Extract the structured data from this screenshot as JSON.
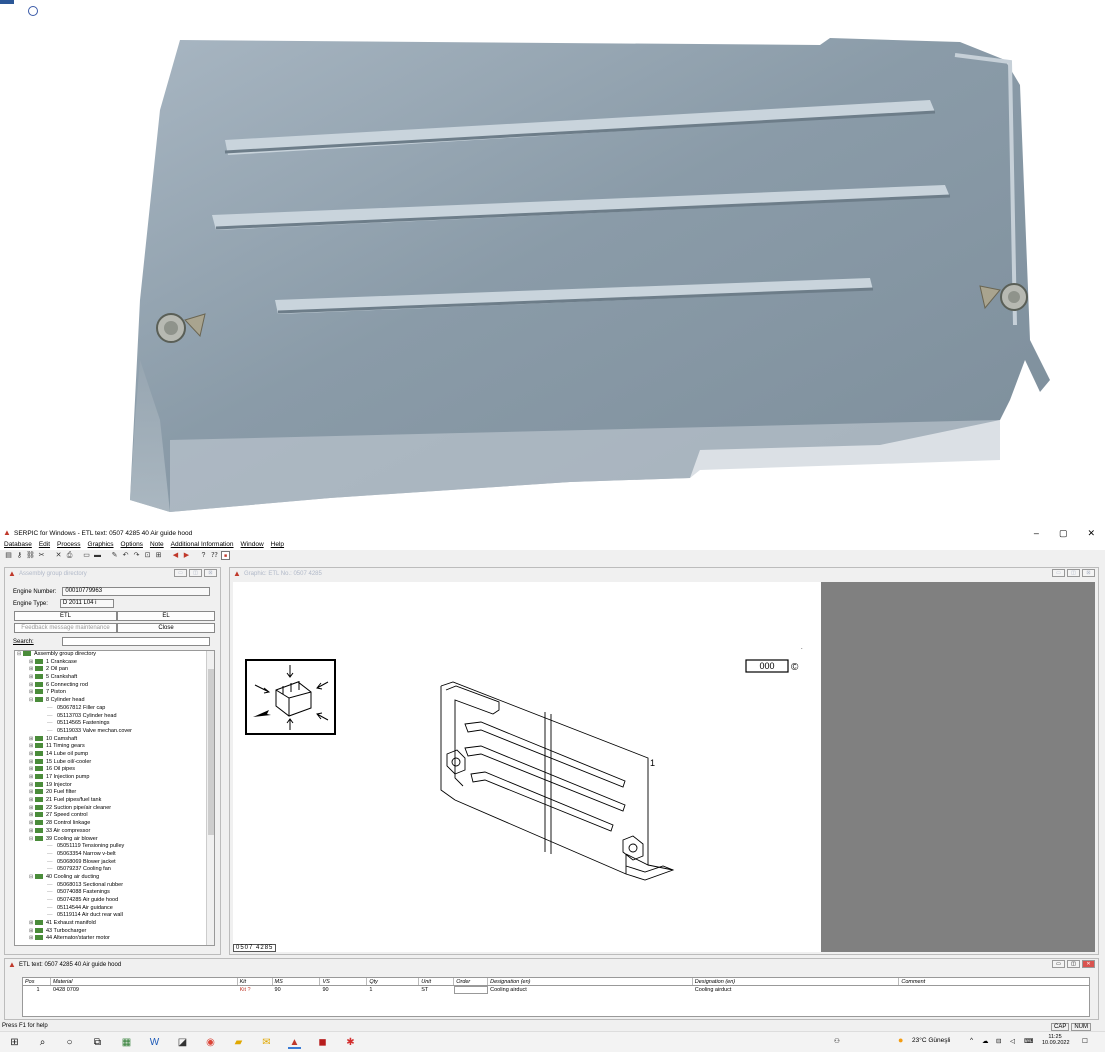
{
  "window": {
    "title": "SERPIC for Windows - ETL text: 0507 4285   40   Air guide hood",
    "controls": [
      "–",
      "▢",
      "✕"
    ]
  },
  "menu": [
    "Database",
    "Edit",
    "Process",
    "Graphics",
    "Options",
    "Note",
    "Additional Information",
    "Window",
    "Help"
  ],
  "assembly_panel": {
    "title": "Assembly group directory",
    "engine_number_label": "Engine Number:",
    "engine_number": "00010779963",
    "engine_type_label": "Engine Type:",
    "engine_type": "D 2011 L04 i",
    "etl_button": "ETL",
    "el_button": "EL",
    "feedback_button": "Feedback message maintenance",
    "close_button": "Close",
    "search_label": "Search:",
    "tree": [
      {
        "t": "Assembly group directory",
        "lvl": 0,
        "tog": "⊟"
      },
      {
        "t": "1  Crankcase",
        "lvl": 1,
        "tog": "⊞"
      },
      {
        "t": "2  Oil pan",
        "lvl": 1,
        "tog": "⊞"
      },
      {
        "t": "5  Crankshaft",
        "lvl": 1,
        "tog": "⊞"
      },
      {
        "t": "6  Connecting rod",
        "lvl": 1,
        "tog": "⊞"
      },
      {
        "t": "7  Piston",
        "lvl": 1,
        "tog": "⊞"
      },
      {
        "t": "8  Cylinder head",
        "lvl": 1,
        "tog": "⊟"
      },
      {
        "t": "05067812  Filler cap",
        "lvl": 2,
        "tog": ""
      },
      {
        "t": "05113703  Cylinder head",
        "lvl": 2,
        "tog": ""
      },
      {
        "t": "05114565  Fastenings",
        "lvl": 2,
        "tog": ""
      },
      {
        "t": "05119033  Valve mechan.cover",
        "lvl": 2,
        "tog": ""
      },
      {
        "t": "10  Camshaft",
        "lvl": 1,
        "tog": "⊞"
      },
      {
        "t": "11  Timing gears",
        "lvl": 1,
        "tog": "⊞"
      },
      {
        "t": "14  Lube oil pump",
        "lvl": 1,
        "tog": "⊞"
      },
      {
        "t": "15  Lube oil/-cooler",
        "lvl": 1,
        "tog": "⊞"
      },
      {
        "t": "16  Oil pipes",
        "lvl": 1,
        "tog": "⊞"
      },
      {
        "t": "17  Injection pump",
        "lvl": 1,
        "tog": "⊞"
      },
      {
        "t": "19  Injector",
        "lvl": 1,
        "tog": "⊞"
      },
      {
        "t": "20  Fuel filter",
        "lvl": 1,
        "tog": "⊞"
      },
      {
        "t": "21  Fuel pipes/fuel tank",
        "lvl": 1,
        "tog": "⊞"
      },
      {
        "t": "22  Suction pipe/air cleaner",
        "lvl": 1,
        "tog": "⊞"
      },
      {
        "t": "27  Speed control",
        "lvl": 1,
        "tog": "⊞"
      },
      {
        "t": "28  Control linkage",
        "lvl": 1,
        "tog": "⊞"
      },
      {
        "t": "33  Air compressor",
        "lvl": 1,
        "tog": "⊞"
      },
      {
        "t": "39  Cooling air blower",
        "lvl": 1,
        "tog": "⊟"
      },
      {
        "t": "05051119  Tensioning pulley",
        "lvl": 2,
        "tog": ""
      },
      {
        "t": "05063354  Narrow v-belt",
        "lvl": 2,
        "tog": ""
      },
      {
        "t": "05068069  Blower jacket",
        "lvl": 2,
        "tog": ""
      },
      {
        "t": "05079237  Cooling fan",
        "lvl": 2,
        "tog": ""
      },
      {
        "t": "40  Cooling air ducting",
        "lvl": 1,
        "tog": "⊟"
      },
      {
        "t": "05068013  Sectional rubber",
        "lvl": 2,
        "tog": ""
      },
      {
        "t": "05074088  Fastenings",
        "lvl": 2,
        "tog": ""
      },
      {
        "t": "05074285  Air guide hood",
        "lvl": 2,
        "tog": ""
      },
      {
        "t": "05114544  Air guidance",
        "lvl": 2,
        "tog": ""
      },
      {
        "t": "05119114  Air duct rear wall",
        "lvl": 2,
        "tog": ""
      },
      {
        "t": "41  Exhaust manifold",
        "lvl": 1,
        "tog": "⊞"
      },
      {
        "t": "43  Turbocharger",
        "lvl": 1,
        "tog": "⊞"
      },
      {
        "t": "44  Alternator/starter motor",
        "lvl": 1,
        "tog": "⊞"
      }
    ]
  },
  "graphic_panel": {
    "title": "Graphic: ETL No.: 0507 4285",
    "label_box": "000",
    "copyright": "©",
    "callout": "1",
    "drawing_number": "0507 4285"
  },
  "etl_panel": {
    "title": "ETL text: 0507 4285   40   Air guide hood",
    "columns": [
      "Pos",
      "Material",
      "Kit",
      "MS",
      "VS",
      "Qty",
      "Unit",
      "Order",
      "Designation (en)",
      "Designation (en)",
      "Comment"
    ],
    "rows": [
      [
        "1",
        "0428 0709",
        "Kit ?",
        "90",
        "90",
        "1",
        "ST",
        "",
        "Cooling airduct",
        "Cooling airduct",
        ""
      ]
    ]
  },
  "status": {
    "help": "Press F1 for help",
    "caps": "CAP",
    "num": "NUM"
  },
  "taskbar": {
    "weather": "23°C  Güneşli",
    "time": "11:25",
    "date": "10.09.2022"
  }
}
